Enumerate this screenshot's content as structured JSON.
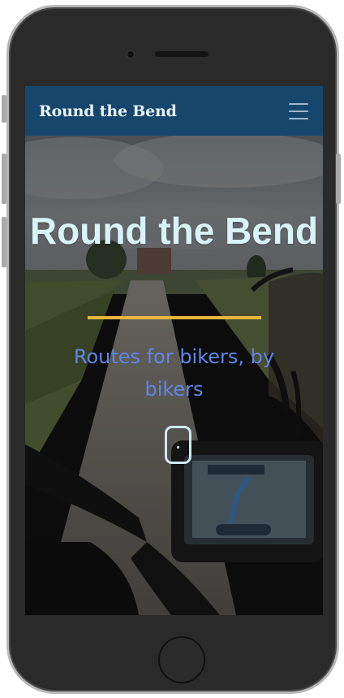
{
  "navbar": {
    "brand": "Round the Bend",
    "menu_icon": "hamburger-menu-icon"
  },
  "hero": {
    "title": "Round the Bend",
    "subtitle": "Routes for bikers, by bikers",
    "scroll_icon": "mouse-scroll-icon",
    "accent_color": "#e8b73e",
    "title_color": "#d8f4f9",
    "subtitle_color": "#5f86e6"
  },
  "colors": {
    "navbar_background": "#17466d"
  }
}
